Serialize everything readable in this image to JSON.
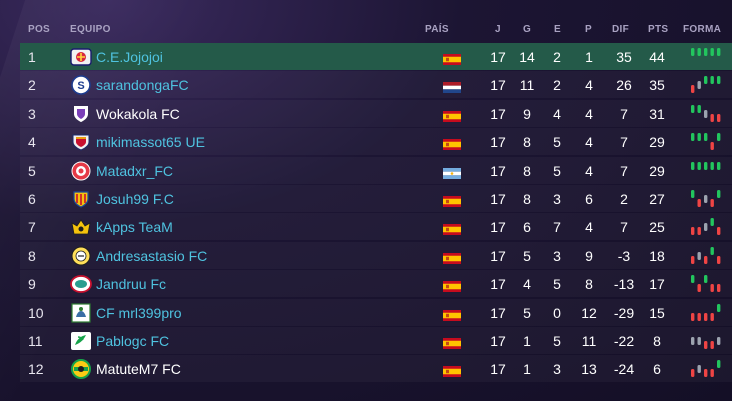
{
  "header": {
    "pos": "POS",
    "equipo": "EQUIPO",
    "pais": "PAÍS",
    "j": "J",
    "g": "G",
    "e": "E",
    "p": "P",
    "dif": "DIF",
    "pts": "PTS",
    "forma": "FORMA"
  },
  "colors": {
    "highlight_row": "#245a49",
    "team_link": "#4fc3e0",
    "win": "#22c55e",
    "draw": "#9ca3af",
    "loss": "#ef4444"
  },
  "rows": [
    {
      "pos": "1",
      "team": "C.E.Jojojoi",
      "country": "spain",
      "j": "17",
      "g": "14",
      "e": "2",
      "p": "1",
      "dif": "35",
      "pts": "44",
      "forma": [
        "W",
        "W",
        "W",
        "W",
        "W"
      ]
    },
    {
      "pos": "2",
      "team": "sarandongaFC",
      "country": "netherlands",
      "j": "17",
      "g": "11",
      "e": "2",
      "p": "4",
      "dif": "26",
      "pts": "35",
      "forma": [
        "L",
        "D",
        "W",
        "W",
        "W"
      ]
    },
    {
      "pos": "3",
      "team": "Wokakola FC",
      "country": "spain",
      "j": "17",
      "g": "9",
      "e": "4",
      "p": "4",
      "dif": "7",
      "pts": "31",
      "forma": [
        "W",
        "W",
        "D",
        "L",
        "L"
      ]
    },
    {
      "pos": "4",
      "team": "mikimassot65 UE",
      "country": "spain",
      "j": "17",
      "g": "8",
      "e": "5",
      "p": "4",
      "dif": "7",
      "pts": "29",
      "forma": [
        "W",
        "W",
        "W",
        "L",
        "W"
      ]
    },
    {
      "pos": "5",
      "team": "Matadxr_FC",
      "country": "argentina",
      "j": "17",
      "g": "8",
      "e": "5",
      "p": "4",
      "dif": "7",
      "pts": "29",
      "forma": [
        "W",
        "W",
        "W",
        "W",
        "W"
      ]
    },
    {
      "pos": "6",
      "team": "Josuh99 F.C",
      "country": "spain",
      "j": "17",
      "g": "8",
      "e": "3",
      "p": "6",
      "dif": "2",
      "pts": "27",
      "forma": [
        "W",
        "L",
        "D",
        "L",
        "W"
      ]
    },
    {
      "pos": "7",
      "team": "kApps TeaM",
      "country": "spain",
      "j": "17",
      "g": "6",
      "e": "7",
      "p": "4",
      "dif": "7",
      "pts": "25",
      "forma": [
        "L",
        "L",
        "D",
        "W",
        "L"
      ]
    },
    {
      "pos": "8",
      "team": "Andresastasio FC",
      "country": "spain",
      "j": "17",
      "g": "5",
      "e": "3",
      "p": "9",
      "dif": "-3",
      "pts": "18",
      "forma": [
        "L",
        "D",
        "L",
        "W",
        "L"
      ]
    },
    {
      "pos": "9",
      "team": "Jandruu Fc",
      "country": "spain",
      "j": "17",
      "g": "4",
      "e": "5",
      "p": "8",
      "dif": "-13",
      "pts": "17",
      "forma": [
        "W",
        "L",
        "W",
        "L",
        "L"
      ]
    },
    {
      "pos": "10",
      "team": "CF mrl399pro",
      "country": "spain",
      "j": "17",
      "g": "5",
      "e": "0",
      "p": "12",
      "dif": "-29",
      "pts": "15",
      "forma": [
        "L",
        "L",
        "L",
        "L",
        "W"
      ]
    },
    {
      "pos": "11",
      "team": "Pablogc FC",
      "country": "spain",
      "j": "17",
      "g": "1",
      "e": "5",
      "p": "11",
      "dif": "-22",
      "pts": "8",
      "forma": [
        "D",
        "D",
        "L",
        "L",
        "D"
      ]
    },
    {
      "pos": "12",
      "team": "MatuteM7 FC",
      "country": "spain",
      "j": "17",
      "g": "1",
      "e": "3",
      "p": "13",
      "dif": "-24",
      "pts": "6",
      "forma": [
        "L",
        "D",
        "L",
        "L",
        "W"
      ]
    }
  ]
}
